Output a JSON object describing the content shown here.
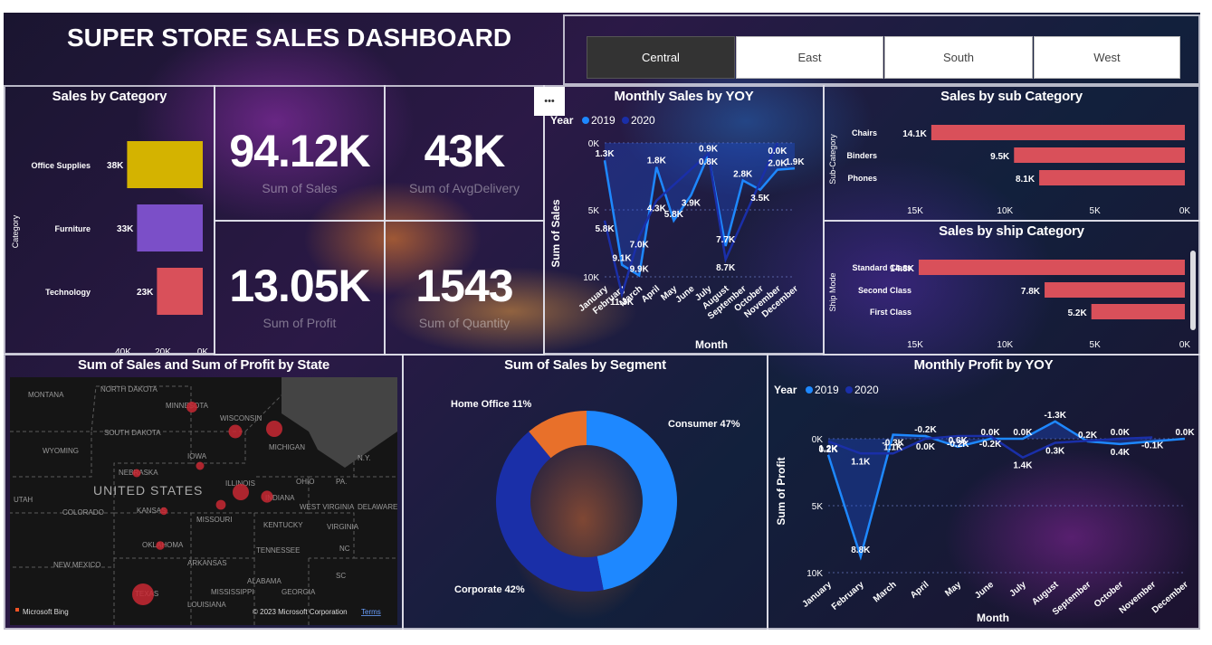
{
  "title": "SUPER STORE SALES DASHBOARD",
  "regions": [
    "Central",
    "East",
    "South",
    "West"
  ],
  "selected_region": "Central",
  "cards": [
    {
      "value": "94.12K",
      "label": "Sum of Sales"
    },
    {
      "value": "43K",
      "label": "Sum of AvgDelivery"
    },
    {
      "value": "13.05K",
      "label": "Sum of Profit"
    },
    {
      "value": "1543",
      "label": "Sum of Quantity"
    }
  ],
  "more_options": "•••",
  "colors": {
    "bar_red": "#d9505a",
    "gold": "#d4b300",
    "purple": "#7b4fc8",
    "blue_2019": "#1e88ff",
    "blue_2020": "#1a2fa8",
    "orange": "#e8702a"
  },
  "chart_data": [
    {
      "id": "sales_by_category",
      "type": "bar",
      "orientation": "horizontal",
      "title": "Sales by Category",
      "ylabel": "Category",
      "xlabel": "",
      "categories": [
        "Office Supplies",
        "Furniture",
        "Technology"
      ],
      "values": [
        38000,
        33000,
        23000
      ],
      "value_labels": [
        "38K",
        "33K",
        "23K"
      ],
      "bar_colors": [
        "#d4b300",
        "#7b4fc8",
        "#d9505a"
      ],
      "xticks": [
        "40K",
        "20K",
        "0K"
      ],
      "xlim": [
        40000,
        0
      ]
    },
    {
      "id": "monthly_sales_yoy",
      "type": "line",
      "title": "Monthly Sales by YOY",
      "xlabel": "Month",
      "ylabel": "Sum of Sales",
      "legend_title": "Year",
      "legend_position": "top-left",
      "categories": [
        "January",
        "February",
        "March",
        "April",
        "May",
        "June",
        "July",
        "August",
        "September",
        "October",
        "November",
        "December"
      ],
      "yticks": [
        "0K",
        "5K",
        "10K"
      ],
      "ylim": [
        0,
        10000
      ],
      "y_inverted": true,
      "series": [
        {
          "name": "2019",
          "color": "#1e88ff",
          "values": [
            1300,
            9100,
            9900,
            1800,
            5800,
            3900,
            900,
            7700,
            2800,
            3500,
            2000,
            1900
          ]
        },
        {
          "name": "2020",
          "color": "#1a2fa8",
          "values": [
            5800,
            11300,
            7000,
            4300,
            null,
            null,
            800,
            8700,
            null,
            null,
            0,
            null
          ]
        }
      ],
      "data_labels": [
        {
          "month": "January",
          "value": 1300,
          "text": "1.3K"
        },
        {
          "month": "January",
          "value": 5800,
          "text": "5.8K"
        },
        {
          "month": "February",
          "value": 9100,
          "text": "9.1K"
        },
        {
          "month": "February",
          "value": 11300,
          "text": "11.3K"
        },
        {
          "month": "March",
          "value": 9900,
          "text": "9.9K"
        },
        {
          "month": "March",
          "value": 7000,
          "text": "7.0K"
        },
        {
          "month": "April",
          "value": 1800,
          "text": "1.8K"
        },
        {
          "month": "April",
          "value": 4300,
          "text": "4.3K"
        },
        {
          "month": "May",
          "value": 5800,
          "text": "5.8K"
        },
        {
          "month": "June",
          "value": 3900,
          "text": "3.9K"
        },
        {
          "month": "July",
          "value": 900,
          "text": "0.9K"
        },
        {
          "month": "July",
          "value": 800,
          "text": "0.8K"
        },
        {
          "month": "August",
          "value": 7700,
          "text": "7.7K"
        },
        {
          "month": "August",
          "value": 8700,
          "text": "8.7K"
        },
        {
          "month": "September",
          "value": 2800,
          "text": "2.8K"
        },
        {
          "month": "October",
          "value": 3500,
          "text": "3.5K"
        },
        {
          "month": "November",
          "value": 2000,
          "text": "2.0K"
        },
        {
          "month": "November",
          "value": 0,
          "text": "0.0K"
        },
        {
          "month": "December",
          "value": 1900,
          "text": "1.9K"
        }
      ]
    },
    {
      "id": "sales_by_sub_category",
      "type": "bar",
      "orientation": "horizontal",
      "title": "Sales by sub Category",
      "ylabel": "Sub-Category",
      "xlabel": "",
      "categories": [
        "Chairs",
        "Binders",
        "Phones"
      ],
      "values": [
        14100,
        9500,
        8100
      ],
      "value_labels": [
        "14.1K",
        "9.5K",
        "8.1K"
      ],
      "xticks": [
        "15K",
        "10K",
        "5K",
        "0K"
      ],
      "xlim": [
        15000,
        0
      ]
    },
    {
      "id": "sales_by_ship_category",
      "type": "bar",
      "orientation": "horizontal",
      "title": "Sales by ship Category",
      "ylabel": "Ship Mode",
      "xlabel": "",
      "categories": [
        "Standard Class",
        "Second Class",
        "First Class"
      ],
      "values": [
        14800,
        7800,
        5200
      ],
      "value_labels": [
        "14.8K",
        "7.8K",
        "5.2K"
      ],
      "xticks": [
        "15K",
        "10K",
        "5K",
        "0K"
      ],
      "xlim": [
        15000,
        0
      ]
    },
    {
      "id": "sales_profit_by_state",
      "type": "scatter",
      "subtype": "map",
      "title": "Sum of Sales and Sum of Profit by State",
      "map_labels": [
        "MONTANA",
        "NORTH DAKOTA",
        "MINNESOTA",
        "WISCONSIN",
        "MICHIGAN",
        "SOUTH DAKOTA",
        "WYOMING",
        "NEBRASKA",
        "IOWA",
        "ILLINOIS",
        "INDIANA",
        "OHIO",
        "UNITED STATES",
        "UTAH",
        "COLORADO",
        "KANSAS",
        "MISSOURI",
        "KENTUCKY",
        "WEST VIRGINIA",
        "VIRGINIA",
        "N.Y.",
        "PA.",
        "DELAWARE",
        "OKLAHOMA",
        "ARKANSAS",
        "TENNESSEE",
        "NC",
        "SC",
        "NEW MEXICO",
        "TEXAS",
        "MISSISSIPPI",
        "ALABAMA",
        "GEORGIA",
        "LOUISIANA"
      ],
      "bubbles": [
        {
          "state": "Texas",
          "size": 3
        },
        {
          "state": "Illinois",
          "size": 2
        },
        {
          "state": "Michigan",
          "size": 2
        },
        {
          "state": "Wisconsin",
          "size": 1.5
        },
        {
          "state": "Indiana",
          "size": 1.2
        },
        {
          "state": "Minnesota",
          "size": 1
        },
        {
          "state": "Missouri",
          "size": 0.8
        },
        {
          "state": "Oklahoma",
          "size": 0.6
        },
        {
          "state": "Nebraska",
          "size": 0.5
        },
        {
          "state": "Iowa",
          "size": 0.5
        },
        {
          "state": "Kansas",
          "size": 0.4
        }
      ],
      "attribution": [
        "Microsoft Bing",
        "© 2023 Microsoft Corporation",
        "Terms"
      ]
    },
    {
      "id": "sales_by_segment",
      "type": "pie",
      "subtype": "donut",
      "title": "Sum of Sales by Segment",
      "categories": [
        "Consumer",
        "Corporate",
        "Home Office"
      ],
      "values": [
        47,
        42,
        11
      ],
      "labels": [
        "Consumer 47%",
        "Corporate 42%",
        "Home Office 11%"
      ],
      "colors": [
        "#1e88ff",
        "#1a2fa8",
        "#e8702a"
      ]
    },
    {
      "id": "monthly_profit_yoy",
      "type": "line",
      "title": "Monthly Profit by YOY",
      "xlabel": "Month",
      "ylabel": "Sum of Profit",
      "legend_title": "Year",
      "legend_position": "top-left",
      "categories": [
        "January",
        "February",
        "March",
        "April",
        "May",
        "June",
        "July",
        "August",
        "September",
        "October",
        "November",
        "December"
      ],
      "yticks": [
        "0K",
        "5K",
        "10K"
      ],
      "ylim": [
        0,
        10000
      ],
      "y_inverted": true,
      "series": [
        {
          "name": "2019",
          "color": "#1e88ff",
          "values": [
            1200,
            8800,
            -300,
            -200,
            600,
            0,
            0,
            -1300,
            200,
            400,
            null,
            0
          ]
        },
        {
          "name": "2020",
          "color": "#1a2fa8",
          "values": [
            200,
            1100,
            1100,
            0,
            -200,
            -200,
            1400,
            300,
            null,
            0,
            -100,
            null
          ]
        }
      ],
      "data_labels": [
        {
          "month": "January",
          "value": 1200,
          "text": "1.2K"
        },
        {
          "month": "January",
          "value": 200,
          "text": "0.2K"
        },
        {
          "month": "February",
          "value": 8800,
          "text": "8.8K"
        },
        {
          "month": "February",
          "value": 1100,
          "text": "1.1K"
        },
        {
          "month": "March",
          "value": 1100,
          "text": "1.1K"
        },
        {
          "month": "March",
          "value": -300,
          "text": "-0.3K"
        },
        {
          "month": "April",
          "value": -200,
          "text": "-0.2K"
        },
        {
          "month": "April",
          "value": 0,
          "text": "0.0K"
        },
        {
          "month": "May",
          "value": 600,
          "text": "0.6K"
        },
        {
          "month": "May",
          "value": -200,
          "text": "-0.2K"
        },
        {
          "month": "June",
          "value": 0,
          "text": "0.0K"
        },
        {
          "month": "June",
          "value": -200,
          "text": "-0.2K"
        },
        {
          "month": "July",
          "value": 0,
          "text": "0.0K"
        },
        {
          "month": "July",
          "value": 1400,
          "text": "1.4K"
        },
        {
          "month": "August",
          "value": -1300,
          "text": "-1.3K"
        },
        {
          "month": "August",
          "value": 300,
          "text": "0.3K"
        },
        {
          "month": "September",
          "value": 200,
          "text": "0.2K"
        },
        {
          "month": "October",
          "value": 400,
          "text": "0.4K"
        },
        {
          "month": "October",
          "value": 0,
          "text": "0.0K"
        },
        {
          "month": "November",
          "value": -100,
          "text": "-0.1K"
        },
        {
          "month": "December",
          "value": 0,
          "text": "0.0K"
        }
      ]
    }
  ]
}
